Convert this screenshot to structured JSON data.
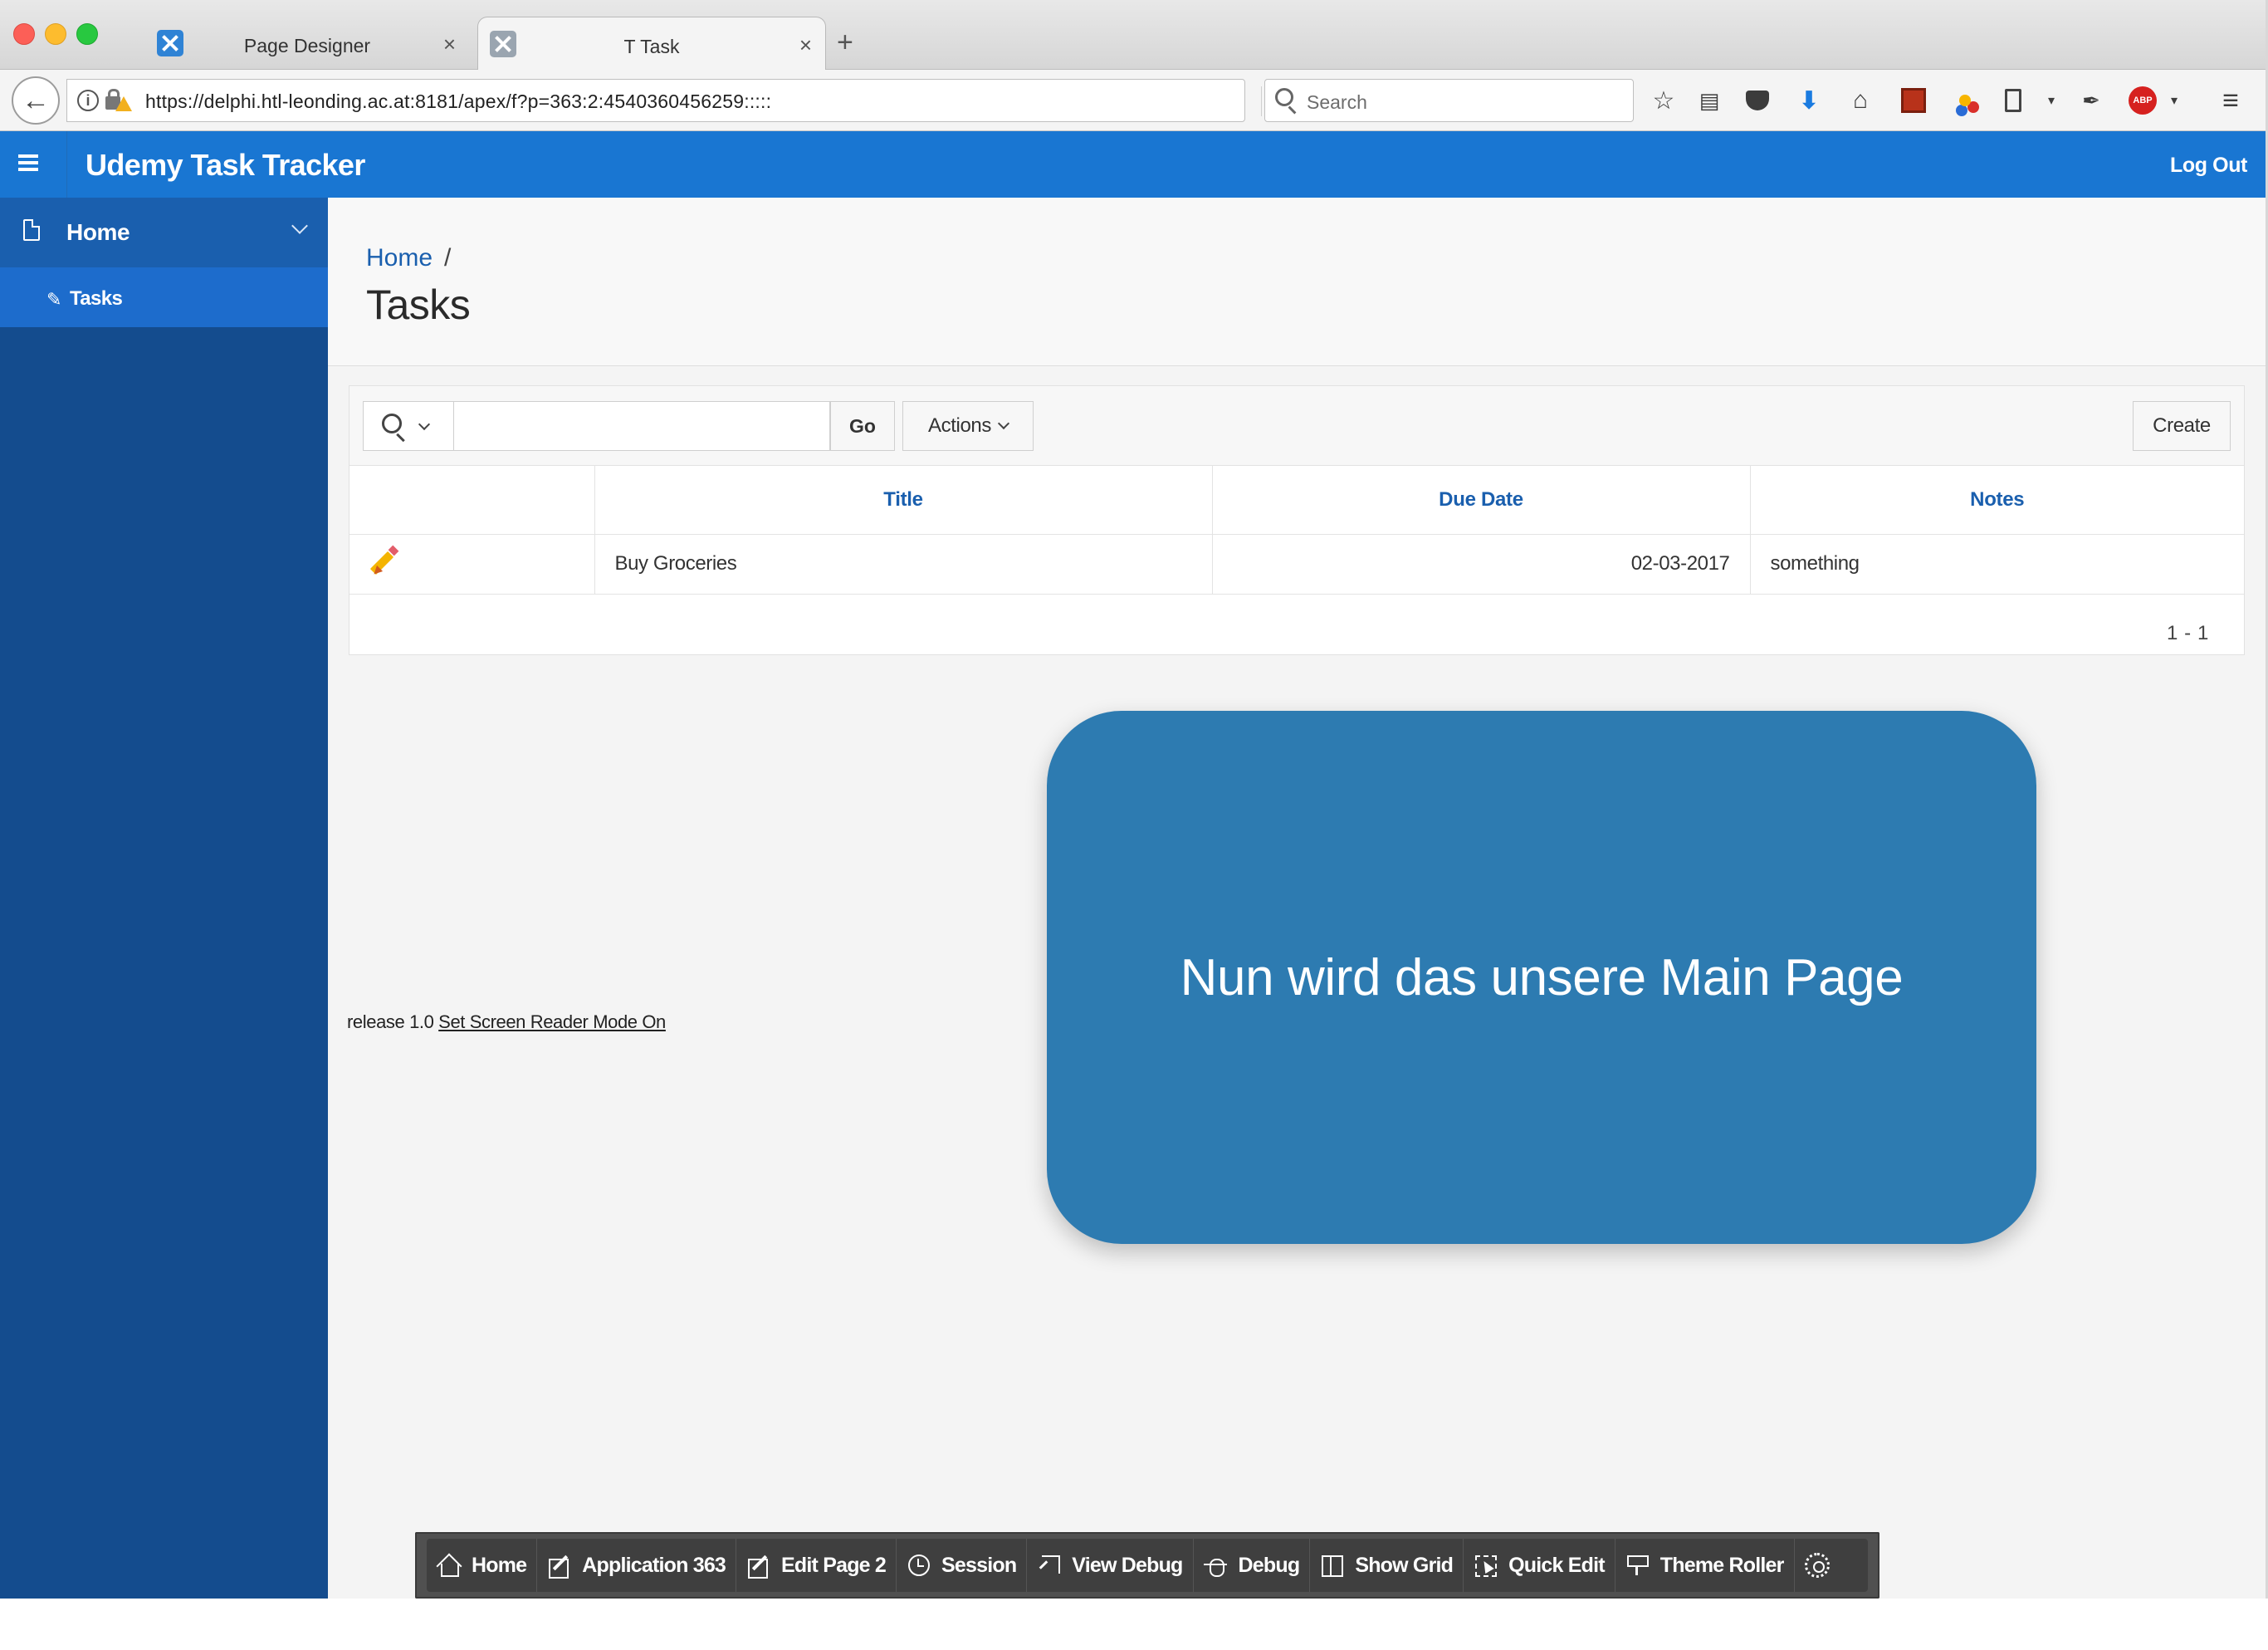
{
  "browser": {
    "tabs": [
      {
        "label": "Page Designer",
        "close": "×"
      },
      {
        "label": "T Task",
        "close": "×"
      }
    ],
    "new_tab": "+",
    "url": "https://delphi.htl-leonding.ac.at:8181/apex/f?p=363:2:4540360456259:::::",
    "search_placeholder": "Search",
    "toolbar_icons": [
      "star-icon",
      "reading-list-icon",
      "pocket-icon",
      "download-icon",
      "home-icon",
      "extension-icon",
      "extension-icon",
      "clipboard-icon",
      "screenshot-icon",
      "adblock-icon",
      "menu-icon"
    ]
  },
  "app": {
    "title": "Udemy Task Tracker",
    "logout_label": "Log Out",
    "brand_color": "#1976d2",
    "sidebar": {
      "items": [
        {
          "label": "Home",
          "icon": "page-icon"
        },
        {
          "label": "Tasks",
          "icon": "pencil-icon"
        }
      ]
    },
    "breadcrumb": {
      "home": "Home",
      "separator": "/"
    },
    "page_title": "Tasks"
  },
  "report": {
    "go_label": "Go",
    "actions_label": "Actions",
    "create_label": "Create",
    "columns": [
      "Title",
      "Due Date",
      "Notes"
    ],
    "rows": [
      {
        "title": "Buy Groceries",
        "due_date": "02-03-2017",
        "notes": "something"
      }
    ],
    "pagination": "1 - 1"
  },
  "footer": {
    "release": "release 1.0",
    "screen_reader_link": "Set Screen Reader Mode On"
  },
  "overlay": {
    "text": "Nun wird das unsere Main Page",
    "color": "#2d7bb1"
  },
  "dev_toolbar": {
    "items": [
      {
        "label": "Home",
        "icon": "home-icon"
      },
      {
        "label": "Application 363",
        "icon": "edit-icon"
      },
      {
        "label": "Edit Page 2",
        "icon": "edit-icon"
      },
      {
        "label": "Session",
        "icon": "clock-icon"
      },
      {
        "label": "View Debug",
        "icon": "view-debug-icon"
      },
      {
        "label": "Debug",
        "icon": "bug-icon"
      },
      {
        "label": "Show Grid",
        "icon": "grid-icon"
      },
      {
        "label": "Quick Edit",
        "icon": "quick-edit-icon"
      },
      {
        "label": "Theme Roller",
        "icon": "paint-roller-icon"
      }
    ]
  }
}
